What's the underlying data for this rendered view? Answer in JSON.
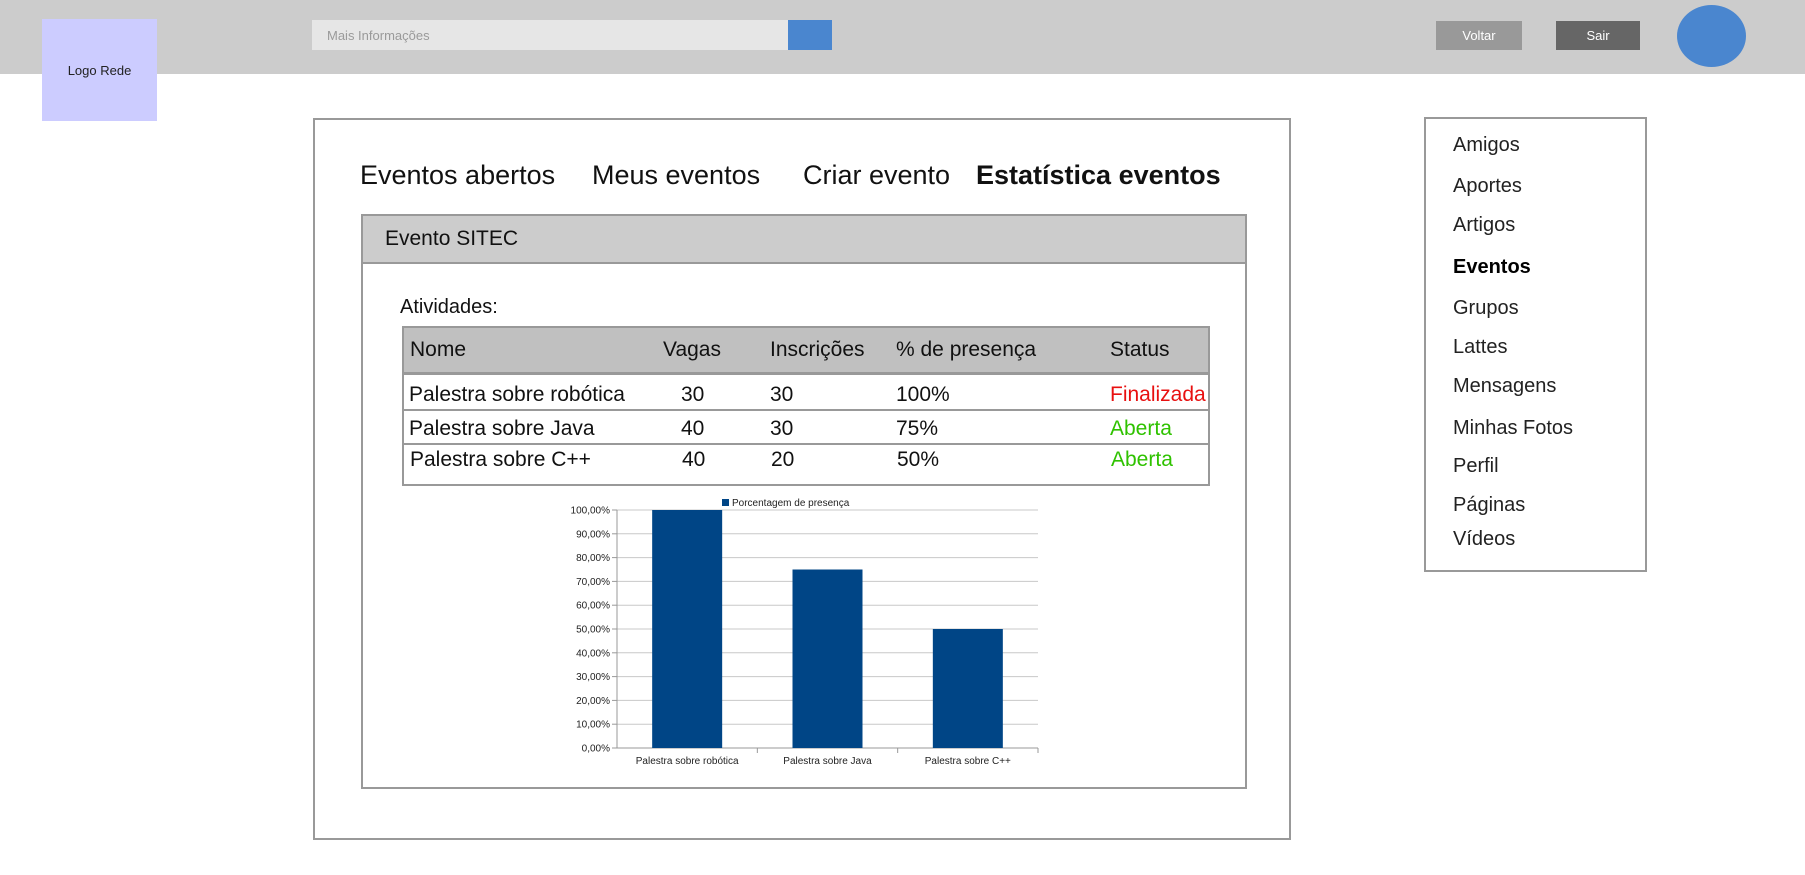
{
  "header": {
    "logo_text": "Logo Rede",
    "search_placeholder": "Mais Informações",
    "back_label": "Voltar",
    "exit_label": "Sair"
  },
  "tabs": [
    {
      "label": "Eventos abertos",
      "active": false
    },
    {
      "label": "Meus eventos",
      "active": false
    },
    {
      "label": "Criar evento",
      "active": false
    },
    {
      "label": "Estatística eventos",
      "active": true
    }
  ],
  "event": {
    "title": "Evento SITEC",
    "activities_label": "Atividades:",
    "columns": [
      "Nome",
      "Vagas",
      "Inscrições",
      "% de presença",
      "Status"
    ],
    "rows": [
      {
        "nome": "Palestra sobre robótica",
        "vagas": "30",
        "inscricoes": "30",
        "presenca": "100%",
        "status": "Finalizada"
      },
      {
        "nome": "Palestra sobre Java",
        "vagas": "40",
        "inscricoes": "30",
        "presenca": "75%",
        "status": "Aberta"
      },
      {
        "nome": "Palestra sobre C++",
        "vagas": "40",
        "inscricoes": "20",
        "presenca": "50%",
        "status": "Aberta"
      }
    ]
  },
  "sidebar": {
    "items": [
      {
        "label": "Amigos",
        "active": false
      },
      {
        "label": "Aportes",
        "active": false
      },
      {
        "label": "Artigos",
        "active": false
      },
      {
        "label": "Eventos",
        "active": true
      },
      {
        "label": "Grupos",
        "active": false
      },
      {
        "label": "Lattes",
        "active": false
      },
      {
        "label": "Mensagens",
        "active": false
      },
      {
        "label": "Minhas Fotos",
        "active": false
      },
      {
        "label": "Perfil",
        "active": false
      },
      {
        "label": "Páginas",
        "active": false
      },
      {
        "label": "Vídeos",
        "active": false
      }
    ]
  },
  "colors": {
    "status_finalizada": "#e81010",
    "status_aberta": "#2fc200",
    "accent": "#4a86cf",
    "bar": "#004586"
  },
  "chart_data": {
    "type": "bar",
    "categories": [
      "Palestra sobre robótica",
      "Palestra sobre Java",
      "Palestra sobre C++"
    ],
    "series": [
      {
        "name": "Porcentagem de presença",
        "values": [
          100,
          75,
          50
        ]
      }
    ],
    "ylim": [
      0,
      100
    ],
    "yticks": [
      "0,00%",
      "10,00%",
      "20,00%",
      "30,00%",
      "40,00%",
      "50,00%",
      "60,00%",
      "70,00%",
      "80,00%",
      "90,00%",
      "100,00%"
    ],
    "grid": true,
    "legend": "top"
  }
}
